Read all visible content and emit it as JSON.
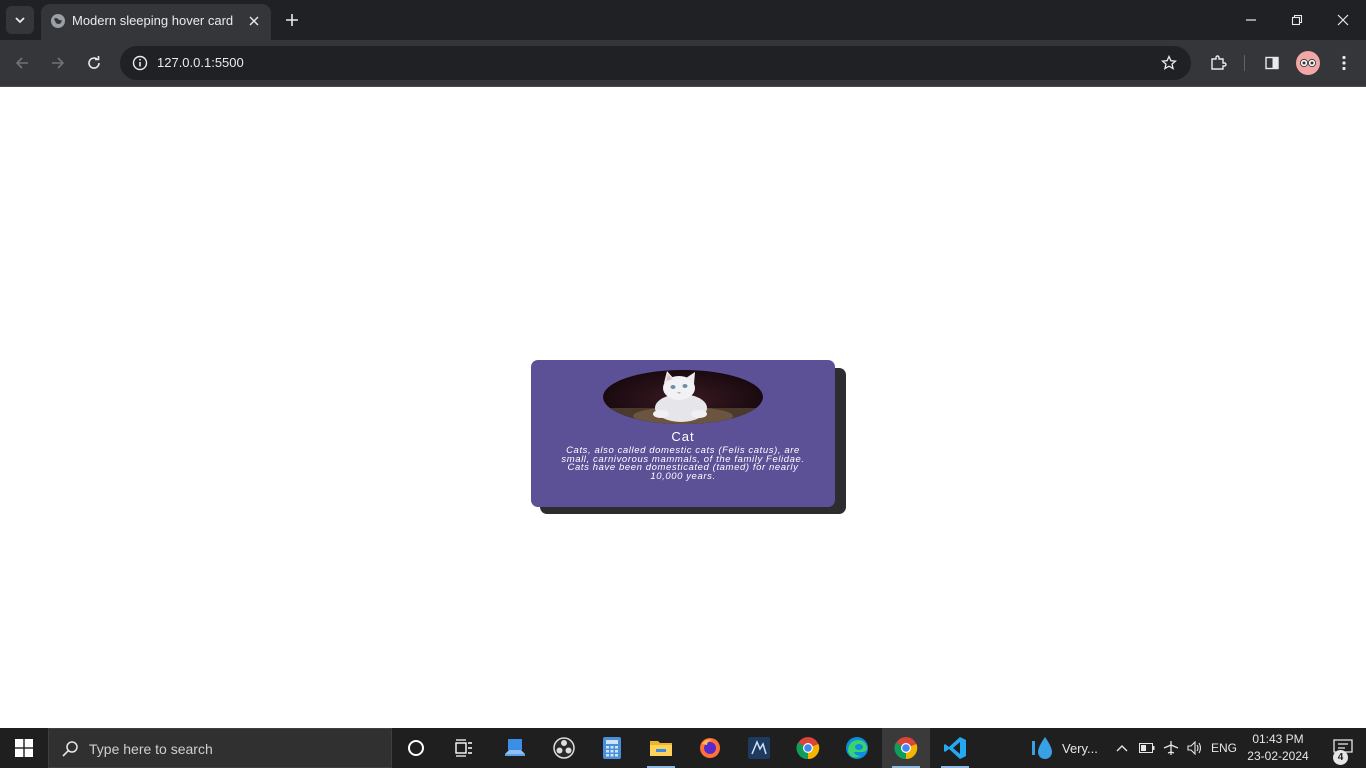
{
  "browser": {
    "tab_title": "Modern sleeping hover card",
    "url": "127.0.0.1:5500"
  },
  "card": {
    "title": "Cat",
    "description": "Cats, also called domestic cats (Felis catus), are small, carnivorous mammals, of the family Felidae. Cats have been domesticated (tamed) for nearly 10,000 years.",
    "background_color": "#5c5096",
    "shadow_color": "#2d2d30"
  },
  "taskbar": {
    "search_placeholder": "Type here to search",
    "weather_text": "Very...",
    "language": "ENG",
    "time": "01:43 PM",
    "date": "23-02-2024",
    "notification_count": "4"
  }
}
